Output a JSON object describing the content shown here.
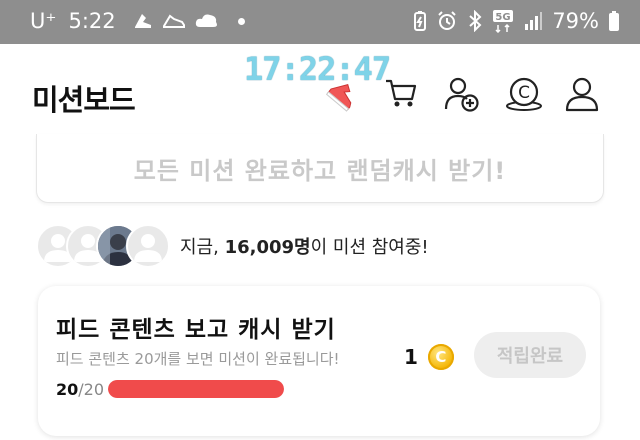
{
  "status_bar": {
    "carrier": "U⁺",
    "time": "5:22",
    "battery": "79%",
    "network": "5G"
  },
  "header": {
    "title": "미션보드",
    "timer": "17:22:47"
  },
  "banner": {
    "text": "모든 미션 완료하고 랜덤캐시 받기!"
  },
  "participants": {
    "prefix": "지금, ",
    "count": "16,009명",
    "suffix": "이 미션 참여중!"
  },
  "mission_card": {
    "title": "피드 콘텐츠 보고 캐시 받기",
    "description": "피드 콘텐츠 20개를 보면 미션이 완료됩니다!",
    "reward": "1",
    "coin_symbol": "C",
    "button_label": "적립완료",
    "progress_done": "20",
    "progress_total": "/20",
    "progress_fraction": 1.0
  },
  "colors": {
    "progress": "#f04b4b",
    "timer": "#7fd3e8",
    "coin": "#f4b400"
  }
}
